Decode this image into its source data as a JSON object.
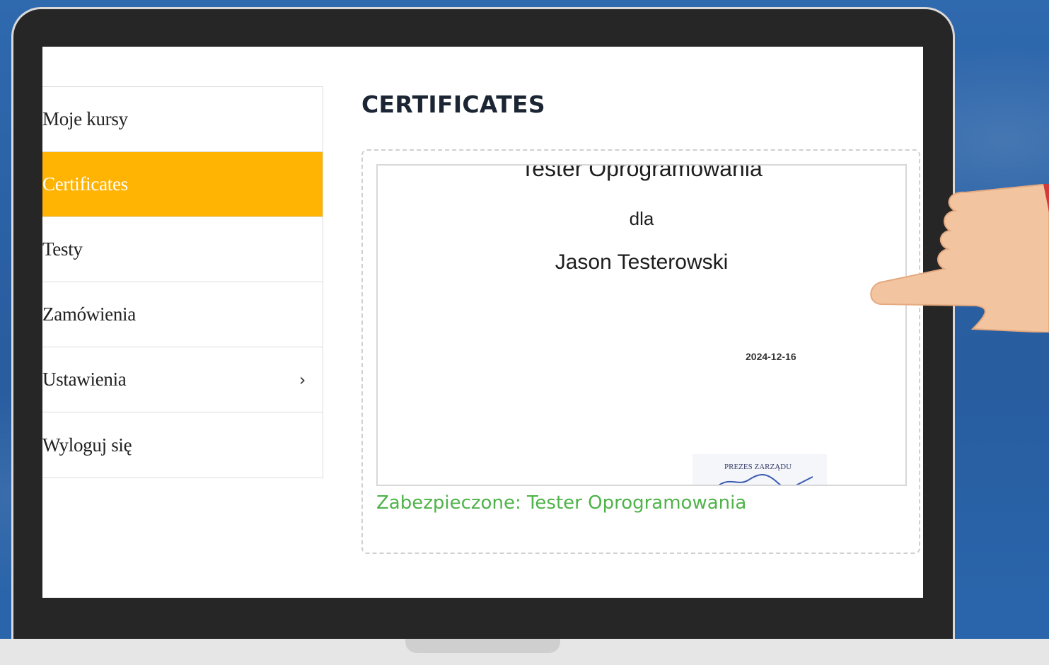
{
  "colors": {
    "accent": "#ffb302",
    "link_green": "#4fb349",
    "background_blue": "#2c64a8"
  },
  "sidebar": {
    "items": [
      {
        "label": "Moje kursy"
      },
      {
        "label": "Certificates"
      },
      {
        "label": "Testy"
      },
      {
        "label": "Zamówienia"
      },
      {
        "label": "Ustawienia",
        "icon": "chevron-right-icon"
      },
      {
        "label": "Wyloguj się"
      }
    ]
  },
  "main": {
    "title": "CERTIFICATES",
    "certificate": {
      "course": "Tester Oprogramowania",
      "for_word": "dla",
      "recipient": "Jason Testerowski",
      "date": "2024-12-16",
      "stamp_text": "PREZES ZARZĄDU",
      "link_text": "Zabezpieczone: Tester Oprogramowania"
    }
  },
  "decorations": {
    "pointer": "pointing-hand-icon"
  }
}
